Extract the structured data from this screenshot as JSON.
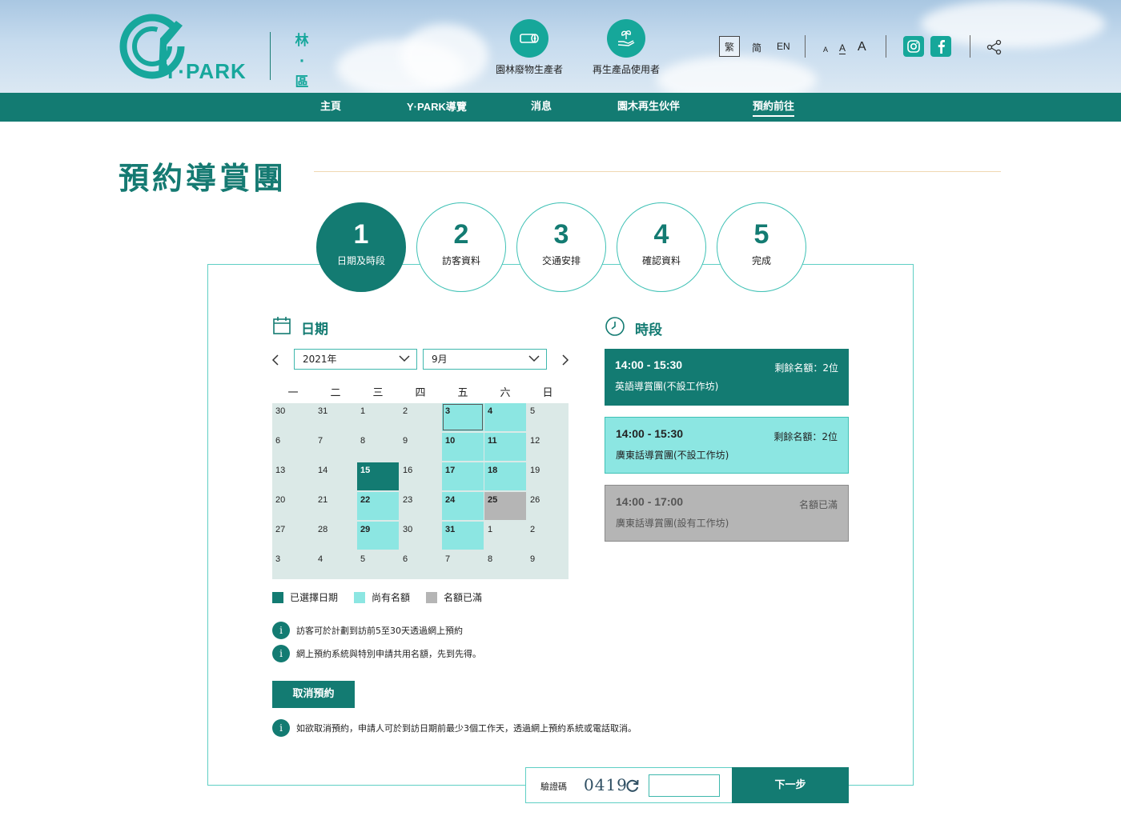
{
  "header": {
    "logo_text": "Y·PARK",
    "zone_chars": [
      "林",
      "·",
      "區"
    ],
    "roles": [
      {
        "label": "園林廢物生產者",
        "icon": "log-icon"
      },
      {
        "label": "再生產品使用者",
        "icon": "hand-sprout-icon"
      }
    ],
    "languages": {
      "tc": "繁",
      "sc": "简",
      "en": "EN"
    },
    "font_sizes": [
      "A",
      "A",
      "A"
    ],
    "social": [
      "instagram-icon",
      "facebook-icon"
    ],
    "share_icon": "share-icon"
  },
  "nav": {
    "items": [
      "主頁",
      "Y·PARK導覽",
      "消息",
      "園木再生伙伴",
      "預約前往"
    ],
    "active_index": 4
  },
  "page": {
    "title": "預約導賞團"
  },
  "steps": [
    {
      "num": "1",
      "label": "日期及時段",
      "active": true
    },
    {
      "num": "2",
      "label": "訪客資料",
      "active": false
    },
    {
      "num": "3",
      "label": "交通安排",
      "active": false
    },
    {
      "num": "4",
      "label": "確認資料",
      "active": false
    },
    {
      "num": "5",
      "label": "完成",
      "active": false
    }
  ],
  "date_section": {
    "title": "日期",
    "year_value": "2021年",
    "month_value": "9月",
    "weekdays": [
      "一",
      "二",
      "三",
      "四",
      "五",
      "六",
      "日"
    ],
    "weeks": [
      [
        {
          "d": "30",
          "s": "none"
        },
        {
          "d": "31",
          "s": "none"
        },
        {
          "d": "1",
          "s": "none"
        },
        {
          "d": "2",
          "s": "none"
        },
        {
          "d": "3",
          "s": "avail",
          "today": true
        },
        {
          "d": "4",
          "s": "avail"
        },
        {
          "d": "5",
          "s": "none"
        }
      ],
      [
        {
          "d": "6",
          "s": "none"
        },
        {
          "d": "7",
          "s": "none"
        },
        {
          "d": "8",
          "s": "none"
        },
        {
          "d": "9",
          "s": "none"
        },
        {
          "d": "10",
          "s": "avail"
        },
        {
          "d": "11",
          "s": "avail"
        },
        {
          "d": "12",
          "s": "none"
        }
      ],
      [
        {
          "d": "13",
          "s": "none"
        },
        {
          "d": "14",
          "s": "none"
        },
        {
          "d": "15",
          "s": "selected"
        },
        {
          "d": "16",
          "s": "none"
        },
        {
          "d": "17",
          "s": "avail"
        },
        {
          "d": "18",
          "s": "avail"
        },
        {
          "d": "19",
          "s": "none"
        }
      ],
      [
        {
          "d": "20",
          "s": "none"
        },
        {
          "d": "21",
          "s": "none"
        },
        {
          "d": "22",
          "s": "avail"
        },
        {
          "d": "23",
          "s": "none"
        },
        {
          "d": "24",
          "s": "avail"
        },
        {
          "d": "25",
          "s": "full"
        },
        {
          "d": "26",
          "s": "none"
        }
      ],
      [
        {
          "d": "27",
          "s": "none"
        },
        {
          "d": "28",
          "s": "none"
        },
        {
          "d": "29",
          "s": "avail"
        },
        {
          "d": "30",
          "s": "none"
        },
        {
          "d": "31",
          "s": "avail"
        },
        {
          "d": "1",
          "s": "none"
        },
        {
          "d": "2",
          "s": "none"
        }
      ],
      [
        {
          "d": "3",
          "s": "none"
        },
        {
          "d": "4",
          "s": "none"
        },
        {
          "d": "5",
          "s": "none"
        },
        {
          "d": "6",
          "s": "none"
        },
        {
          "d": "7",
          "s": "none"
        },
        {
          "d": "8",
          "s": "none"
        },
        {
          "d": "9",
          "s": "none"
        }
      ]
    ],
    "legend": {
      "selected": "已選擇日期",
      "available": "尚有名額",
      "full": "名額已滿"
    },
    "notes": [
      "訪客可於計劃到訪前5至30天透過網上預約",
      "網上預約系統與特別申請共用名額，先到先得。"
    ],
    "cancel_button": "取消預約",
    "cancel_note": "如欲取消預約，申請人可於到訪日期前最少3個工作天，透過網上預約系統或電話取消。"
  },
  "time_section": {
    "title": "時段",
    "slots": [
      {
        "time": "14:00 - 15:30",
        "quota": "剩餘名額：2位",
        "name": "英語導賞團(不設工作坊)",
        "state": "selected"
      },
      {
        "time": "14:00 - 15:30",
        "quota": "剩餘名額：2位",
        "name": "廣東話導賞團(不設工作坊)",
        "state": "available"
      },
      {
        "time": "14:00 - 17:00",
        "quota": "名額已滿",
        "name": "廣東話導賞團(設有工作坊)",
        "state": "full"
      }
    ]
  },
  "footer": {
    "captcha_label": "驗證碼",
    "captcha_code": "0419",
    "captcha_input_value": "",
    "next_button": "下一步"
  },
  "colors": {
    "primary": "#137b72",
    "accent": "#16a79a",
    "available": "#8ce6e2",
    "full": "#b5b5b5",
    "calendar_bg": "#dbe9e7"
  }
}
